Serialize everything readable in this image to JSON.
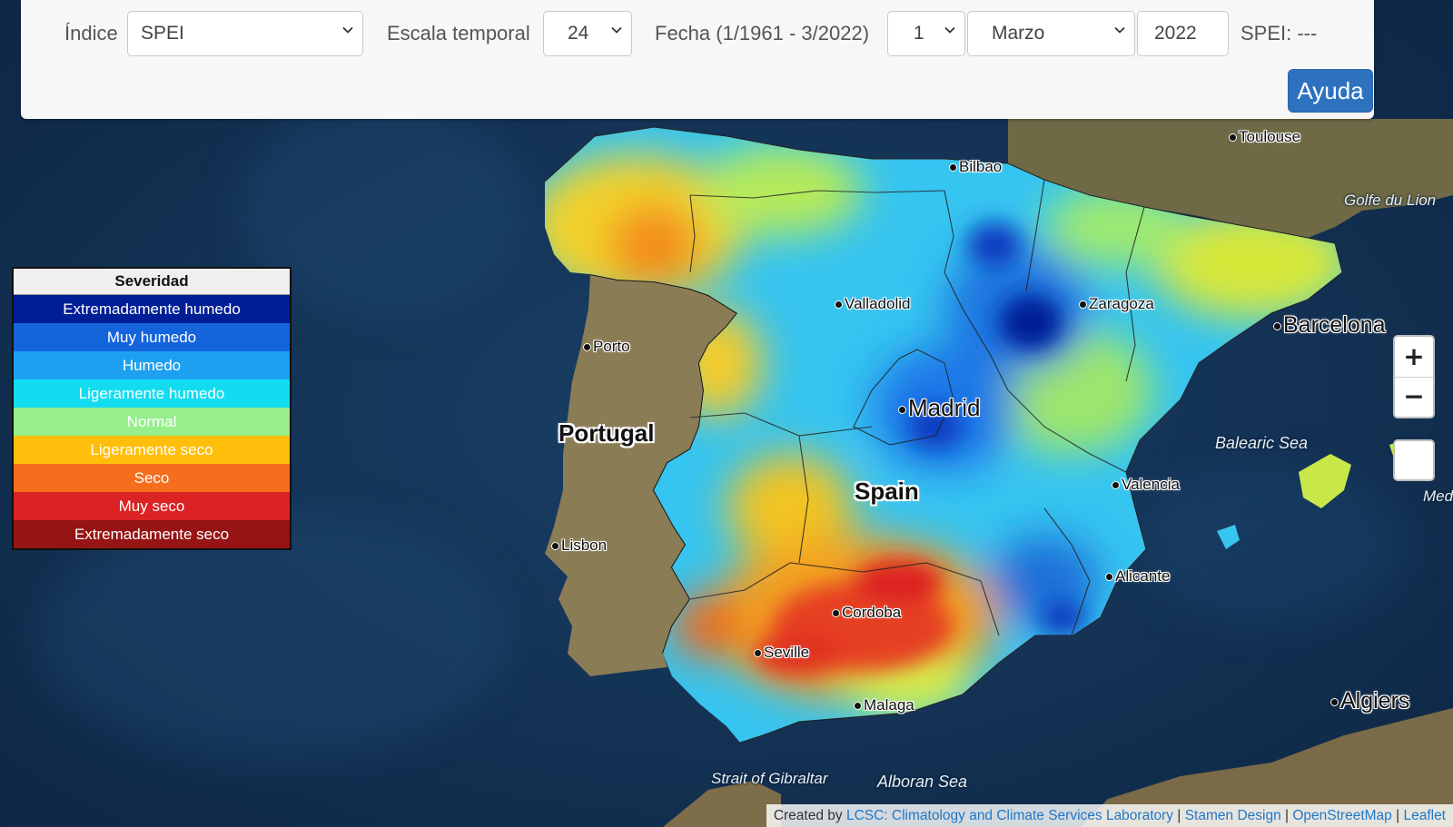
{
  "controls": {
    "indice_label": "Índice",
    "indice_value": "SPEI",
    "escala_label": "Escala temporal",
    "escala_value": "24",
    "fecha_label": "Fecha (1/1961 - 3/2022)",
    "day_value": "1",
    "month_value": "Marzo",
    "year_value": "2022",
    "spei_readout": "SPEI: ---",
    "help_button": "Ayuda"
  },
  "legend": {
    "title": "Severidad",
    "items": [
      {
        "label": "Extremadamente humedo",
        "color": "#001e96"
      },
      {
        "label": "Muy humedo",
        "color": "#1465dc"
      },
      {
        "label": "Humedo",
        "color": "#1ea0f0"
      },
      {
        "label": "Ligeramente humedo",
        "color": "#14dcf0"
      },
      {
        "label": "Normal",
        "color": "#96ee8c"
      },
      {
        "label": "Ligeramente seco",
        "color": "#ffbe0a"
      },
      {
        "label": "Seco",
        "color": "#f56e1e"
      },
      {
        "label": "Muy seco",
        "color": "#dc2323"
      },
      {
        "label": "Extremadamente seco",
        "color": "#961414"
      }
    ]
  },
  "map": {
    "countries": {
      "portugal": "Portugal",
      "spain": "Spain"
    },
    "cities": {
      "toulouse": "Toulouse",
      "bilbao": "Bilbao",
      "valladolid": "Valladolid",
      "zaragoza": "Zaragoza",
      "barcelona": "Barcelona",
      "porto": "Porto",
      "madrid": "Madrid",
      "valencia": "Valencia",
      "lisbon": "Lisbon",
      "alicante": "Alicante",
      "cordoba": "Cordoba",
      "seville": "Seville",
      "malaga": "Malaga",
      "algiers": "Algiers"
    },
    "seas": {
      "golfe": "Golfe du Lion",
      "balearic": "Balearic Sea",
      "gibraltar": "Strait of Gibraltar",
      "alboran": "Alboran Sea",
      "med": "Med"
    }
  },
  "zoom": {
    "in_label": "+",
    "out_label": "−"
  },
  "attribution": {
    "prefix": "Created by",
    "lcsc": "LCSC: Climatology and Climate Services Laboratory",
    "sep": "|",
    "stamen": "Stamen Design",
    "osm": "OpenStreetMap",
    "leaflet": "Leaflet"
  }
}
